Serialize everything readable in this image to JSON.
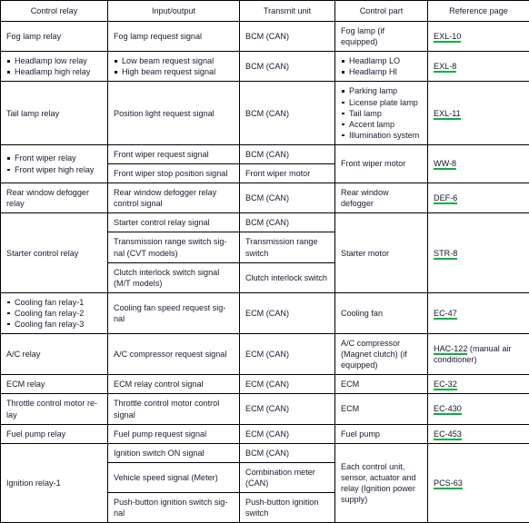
{
  "table": {
    "headers": [
      "Control relay",
      "Input/output",
      "Transmit unit",
      "Control part",
      "Reference page"
    ],
    "rows": [
      {
        "control_relay": "Fog lamp relay",
        "input_output": "Fog lamp request signal",
        "transmit_unit": "BCM (CAN)",
        "control_part": "Fog lamp (if equipped)",
        "reference": "EXL-10"
      },
      {
        "control_relay_items": [
          "Headlamp low relay",
          "Headlamp high relay"
        ],
        "input_output_items": [
          "Low beam request signal",
          "High beam request signal"
        ],
        "transmit_unit": "BCM (CAN)",
        "control_part_items": [
          "Headlamp LO",
          "Headlamp HI"
        ],
        "reference": "EXL-8"
      },
      {
        "control_relay": "Tail lamp relay",
        "input_output": "Position light request signal",
        "transmit_unit": "BCM (CAN)",
        "control_part_items": [
          "Parking lamp",
          "License plate lamp",
          "Tail lamp",
          "Accent lamp",
          "Illumination system"
        ],
        "reference": "EXL-11"
      },
      {
        "control_relay_items": [
          "Front wiper relay",
          "Front wiper high relay"
        ],
        "sub_rows": [
          {
            "input_output": "Front wiper request signal",
            "transmit_unit": "BCM (CAN)"
          },
          {
            "input_output": "Front wiper stop position signal",
            "transmit_unit": "Front wiper motor"
          }
        ],
        "control_part": "Front wiper motor",
        "reference": "WW-8"
      },
      {
        "control_relay": "Rear window defogger relay",
        "input_output": "Rear window defogger relay control signal",
        "transmit_unit": "BCM (CAN)",
        "control_part": "Rear window defogger",
        "reference": "DEF-6"
      },
      {
        "control_relay": "Starter control relay",
        "sub_rows": [
          {
            "input_output": "Starter control relay signal",
            "transmit_unit": "BCM (CAN)"
          },
          {
            "input_output": "Transmission range switch sig-nal (CVT models)",
            "transmit_unit": "Transmission range switch"
          },
          {
            "input_output": "Clutch interlock switch signal (M/T models)",
            "transmit_unit": "Clutch interlock switch"
          }
        ],
        "control_part": "Starter motor",
        "reference": "STR-8"
      },
      {
        "control_relay_items": [
          "Cooling fan relay-1",
          "Cooling fan relay-2",
          "Cooling fan relay-3"
        ],
        "input_output": "Cooling fan speed request sig-nal",
        "transmit_unit": "ECM (CAN)",
        "control_part": "Cooling fan",
        "reference": "EC-47"
      },
      {
        "control_relay": "A/C relay",
        "input_output": "A/C compressor request signal",
        "transmit_unit": "ECM (CAN)",
        "control_part": "A/C compressor (Magnet clutch) (if equipped)",
        "reference": "HAC-122",
        "reference_extra": " (manual air conditioner)"
      },
      {
        "control_relay": "ECM relay",
        "input_output": "ECM relay control signal",
        "transmit_unit": "ECM (CAN)",
        "control_part": "ECM",
        "reference": "EC-32"
      },
      {
        "control_relay": "Throttle control motor re-lay",
        "input_output": "Throttle control motor control signal",
        "transmit_unit": "ECM (CAN)",
        "control_part": "ECM",
        "reference": "EC-430"
      },
      {
        "control_relay": "Fuel pump relay",
        "input_output": "Fuel pump request signal",
        "transmit_unit": "ECM (CAN)",
        "control_part": "Fuel pump",
        "reference": "EC-453"
      },
      {
        "control_relay": "Ignition relay-1",
        "sub_rows": [
          {
            "input_output": "Ignition switch ON signal",
            "transmit_unit": "BCM (CAN)"
          },
          {
            "input_output": "Vehicle speed signal (Meter)",
            "transmit_unit": "Combination meter (CAN)"
          },
          {
            "input_output": "Push-button ignition switch sig-nal",
            "transmit_unit": "Push-button ignition switch"
          }
        ],
        "control_part": "Each control unit, sensor, actuator and relay (Ignition power supply)",
        "reference": "PCS-63"
      }
    ]
  },
  "colors": {
    "link_underline": "#00b33c",
    "text": "#1a1a2e",
    "border": "#000000"
  }
}
